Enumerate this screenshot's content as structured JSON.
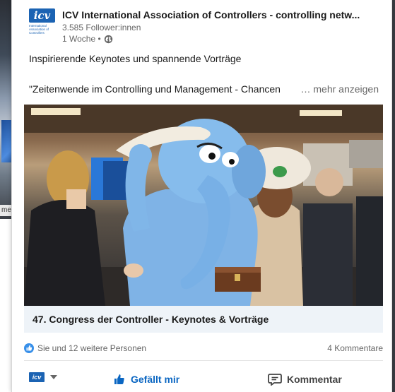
{
  "post": {
    "author": {
      "logo_text": "icv",
      "logo_subtext": "International Association of Controllers",
      "name": "ICV International Association of Controllers - controlling netw...",
      "followers": "3.585 Follower:innen",
      "time": "1 Woche •",
      "visibility_icon": "globe-icon"
    },
    "text_line1": "Inspirierende Keynotes und spannende Vorträge",
    "text_line2": "\"Zeitenwende im Controlling und Management - Chancen",
    "see_more": "… mehr anzeigen",
    "image_alt": "Blue elephant mascot wearing a large hat at a conference",
    "link_title": "47. Congress der Controller - Keynotes & Vorträge"
  },
  "social": {
    "reactions": "Sie und 12 weitere Personen",
    "comments": "4 Kommentare"
  },
  "actions": {
    "actor_logo": "icv",
    "like_label": "Gefällt mir",
    "comment_label": "Kommentar"
  },
  "background": {
    "partial_label": "me"
  },
  "colors": {
    "brand": "#1b63b3",
    "like": "#0a66c2"
  }
}
